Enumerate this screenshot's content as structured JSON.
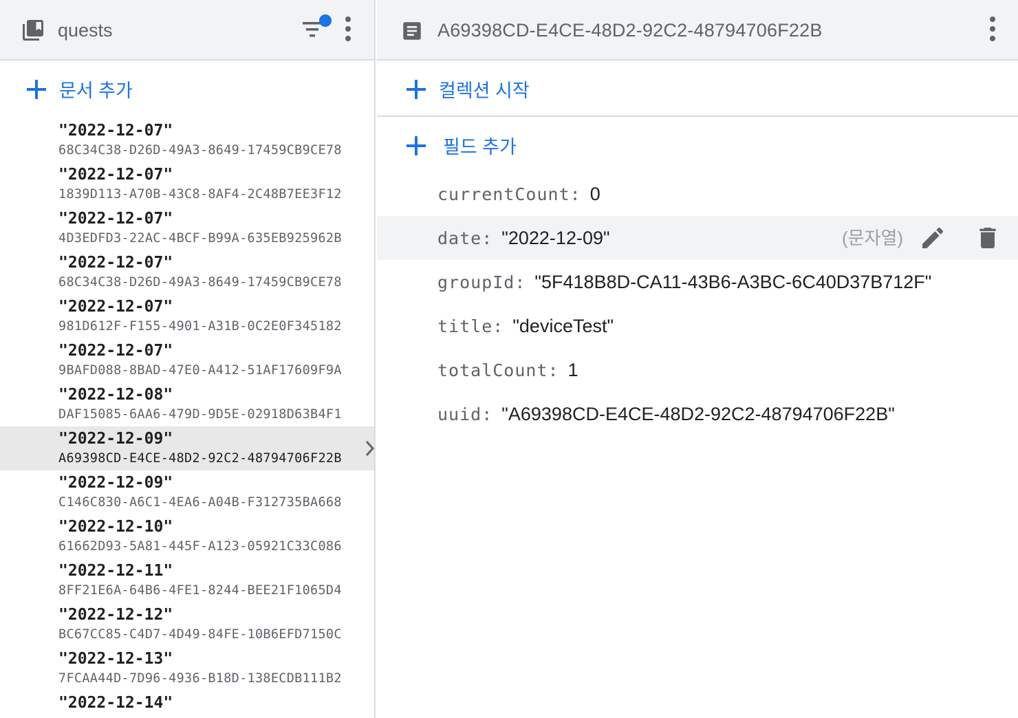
{
  "collection": {
    "title": "quests",
    "icon": "collection-icon",
    "add_document_label": "문서 추가",
    "documents": [
      {
        "name": "\"2022-12-07\"",
        "id": "68C34C38-D26D-49A3-8649-17459CB9CE78"
      },
      {
        "name": "\"2022-12-07\"",
        "id": "1839D113-A70B-43C8-8AF4-2C48B7EE3F12"
      },
      {
        "name": "\"2022-12-07\"",
        "id": "4D3EDFD3-22AC-4BCF-B99A-635EB925962B"
      },
      {
        "name": "\"2022-12-07\"",
        "id": "68C34C38-D26D-49A3-8649-17459CB9CE78"
      },
      {
        "name": "\"2022-12-07\"",
        "id": "981D612F-F155-4901-A31B-0C2E0F345182"
      },
      {
        "name": "\"2022-12-07\"",
        "id": "9BAFD088-8BAD-47E0-A412-51AF17609F9A"
      },
      {
        "name": "\"2022-12-08\"",
        "id": "DAF15085-6AA6-479D-9D5E-02918D63B4F1"
      },
      {
        "name": "\"2022-12-09\"",
        "id": "A69398CD-E4CE-48D2-92C2-48794706F22B",
        "selected": true
      },
      {
        "name": "\"2022-12-09\"",
        "id": "C146C830-A6C1-4EA6-A04B-F312735BA668"
      },
      {
        "name": "\"2022-12-10\"",
        "id": "61662D93-5A81-445F-A123-05921C33C086"
      },
      {
        "name": "\"2022-12-11\"",
        "id": "8FF21E6A-64B6-4FE1-8244-BEE21F1065D4"
      },
      {
        "name": "\"2022-12-12\"",
        "id": "BC67CC85-C4D7-4D49-84FE-10B6EFD7150C"
      },
      {
        "name": "\"2022-12-13\"",
        "id": "7FCAA44D-7D96-4936-B18D-138ECDB111B2"
      },
      {
        "name": "\"2022-12-14\"",
        "id": ""
      }
    ]
  },
  "document": {
    "title": "A69398CD-E4CE-48D2-92C2-48794706F22B",
    "icon": "document-icon",
    "start_collection_label": "컬렉션 시작",
    "add_field_label": "필드 추가",
    "fields": [
      {
        "key": "currentCount",
        "value": "0"
      },
      {
        "key": "date",
        "value": "\"2022-12-09\"",
        "type": "(문자열)"
      },
      {
        "key": "groupId",
        "value": "\"5F418B8D-CA11-43B6-A3BC-6C40D37B712F\""
      },
      {
        "key": "title",
        "value": "\"deviceTest\""
      },
      {
        "key": "totalCount",
        "value": "1"
      },
      {
        "key": "uuid",
        "value": "\"A69398CD-E4CE-48D2-92C2-48794706F22B\""
      }
    ]
  },
  "colors": {
    "accent": "#1a73e8",
    "filter_dot": "#1a73e8",
    "header_bg": "#f1f3f4",
    "selected_bg": "#e8e8e8"
  }
}
